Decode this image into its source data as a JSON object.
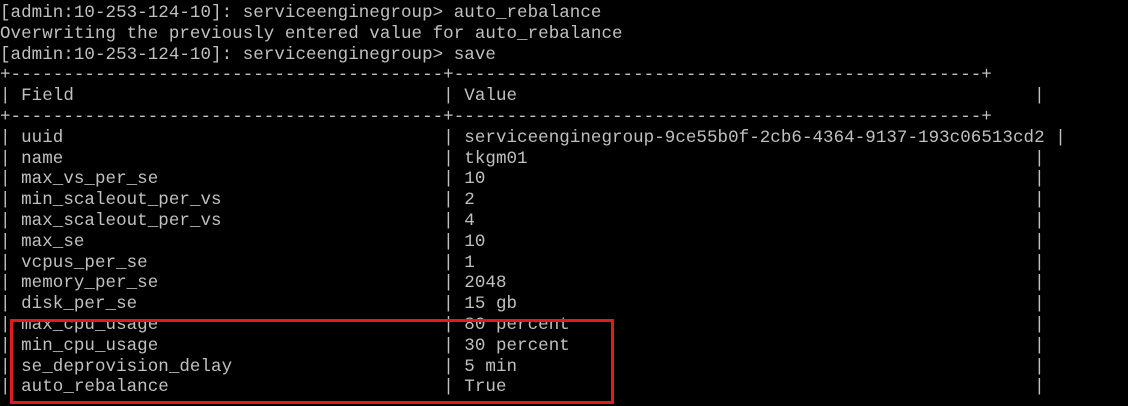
{
  "terminal": {
    "commands": [
      {
        "prompt": "[admin:10-253-124-10]: serviceenginegroup> ",
        "command": "auto_rebalance"
      },
      {
        "message": "Overwriting the previously entered value for auto_rebalance"
      },
      {
        "prompt": "[admin:10-253-124-10]: serviceenginegroup> ",
        "command": "save"
      }
    ],
    "table": {
      "border_top": "+-----------------------------------------+--------------------------------------------------+",
      "header": {
        "field": "Field",
        "value": "Value"
      },
      "rows": [
        {
          "field": "uuid",
          "value": "serviceenginegroup-9ce55b0f-2cb6-4364-9137-193c06513cd2"
        },
        {
          "field": "name",
          "value": "tkgm01"
        },
        {
          "field": "max_vs_per_se",
          "value": "10"
        },
        {
          "field": "min_scaleout_per_vs",
          "value": "2"
        },
        {
          "field": "max_scaleout_per_vs",
          "value": "4"
        },
        {
          "field": "max_se",
          "value": "10"
        },
        {
          "field": "vcpus_per_se",
          "value": "1"
        },
        {
          "field": "memory_per_se",
          "value": "2048"
        },
        {
          "field": "disk_per_se",
          "value": "15 gb"
        },
        {
          "field": "max_cpu_usage",
          "value": "80 percent"
        },
        {
          "field": "min_cpu_usage",
          "value": "30 percent"
        },
        {
          "field": "se_deprovision_delay",
          "value": "5 min"
        },
        {
          "field": "auto_rebalance",
          "value": "True"
        }
      ]
    },
    "colors": {
      "background": "#000000",
      "text": "#c0c0c0",
      "highlight": "#e01b1b"
    }
  }
}
